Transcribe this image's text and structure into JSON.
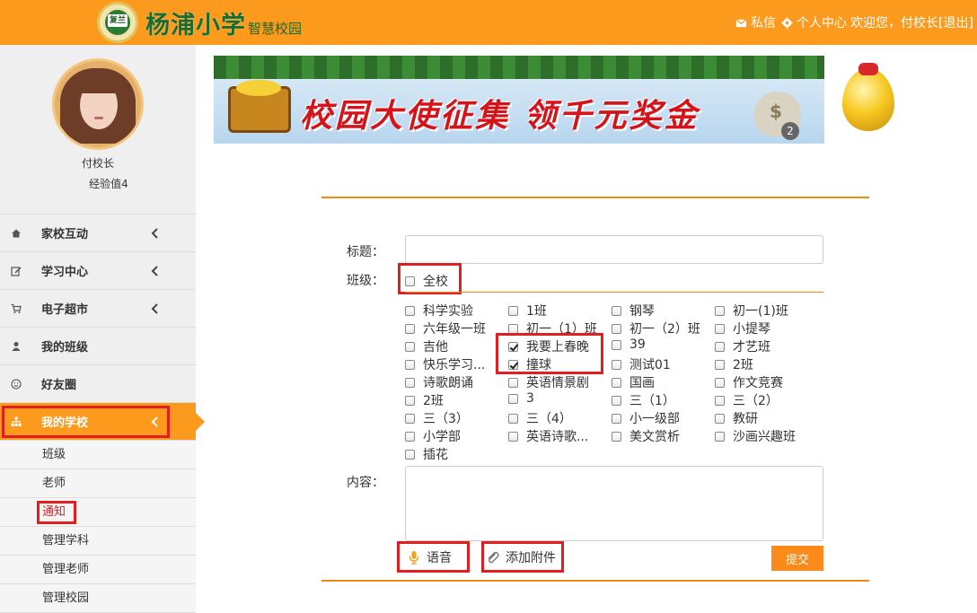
{
  "header": {
    "logo_badge_text": "复兰",
    "school_name": "杨浦小学",
    "subtitle": "智慧校园",
    "messages_label": "私信",
    "personal_center_label": "个人中心",
    "welcome_text": "欢迎您，付校长",
    "logout_label": "[退出]"
  },
  "sidebar": {
    "user_name": "付校长",
    "experience": "经验值4",
    "menu": [
      {
        "label": "家校互动",
        "icon": "home-icon",
        "has_chevron": true
      },
      {
        "label": "学习中心",
        "icon": "edit-icon",
        "has_chevron": true
      },
      {
        "label": "电子超市",
        "icon": "cart-icon",
        "has_chevron": true
      },
      {
        "label": "我的班级",
        "icon": "user-icon",
        "has_chevron": false
      },
      {
        "label": "好友圈",
        "icon": "smile-icon",
        "has_chevron": false
      },
      {
        "label": "我的学校",
        "icon": "sitemap-icon",
        "has_chevron": true,
        "active": true
      }
    ],
    "submenu": [
      {
        "label": "班级"
      },
      {
        "label": "老师"
      },
      {
        "label": "通知",
        "active": true
      },
      {
        "label": "管理学科"
      },
      {
        "label": "管理老师"
      },
      {
        "label": "管理校园"
      }
    ]
  },
  "banner": {
    "text": "校园大使征集  领千元奖金",
    "badge": "2",
    "bag_symbol": "$"
  },
  "form": {
    "title_label": "标题：",
    "title_value": "",
    "class_label": "班级：",
    "all_school_label": "全校",
    "all_school_checked": false,
    "classes": [
      [
        "科学实验",
        "1班",
        "钢琴",
        "初一(1)班"
      ],
      [
        "六年级一班",
        "初一（1）班",
        "初一（2）班",
        "小提琴"
      ],
      [
        "吉他",
        "我要上春晚",
        "39",
        "才艺班"
      ],
      [
        "快乐学习...",
        "撞球",
        "测试01",
        "2班"
      ],
      [
        "诗歌朗诵",
        "英语情景剧",
        "国画",
        "作文竞赛"
      ],
      [
        "2班",
        "3",
        "三（1）",
        "三（2）"
      ],
      [
        "三（3）",
        "三（4）",
        "小一级部",
        "教研"
      ],
      [
        "小学部",
        "英语诗歌...",
        "美文赏析",
        "沙画兴趣班"
      ],
      [
        "插花"
      ]
    ],
    "checked_classes": [
      "我要上春晚",
      "撞球"
    ],
    "content_label": "内容：",
    "content_value": "",
    "voice_label": "语音",
    "attach_label": "添加附件",
    "submit_label": "提交"
  },
  "colors": {
    "brand_orange": "#fb9a1c",
    "school_green": "#1a6b2e",
    "highlight_red": "#e02020"
  }
}
